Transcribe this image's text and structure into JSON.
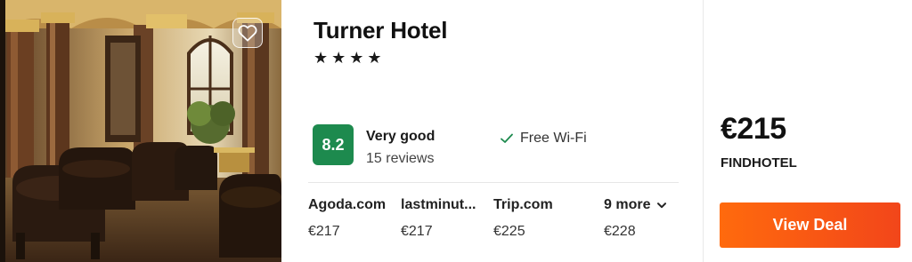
{
  "hotel": {
    "name": "Turner Hotel",
    "stars_text": "★★★★",
    "star_rating": 4
  },
  "rating": {
    "score": "8.2",
    "label": "Very good",
    "reviews": "15 reviews"
  },
  "amenities": [
    {
      "icon": "checkmark-icon",
      "label": "Free Wi-Fi"
    }
  ],
  "providers": [
    {
      "name": "Agoda.com",
      "price": "€217"
    },
    {
      "name": "lastminut...",
      "price": "€217"
    },
    {
      "name": "Trip.com",
      "price": "€225"
    },
    {
      "name": "9 more",
      "price": "€228",
      "icon": "chevron-down-icon"
    }
  ],
  "best_deal": {
    "price": "€215",
    "provider": "FINDHOTEL",
    "button_label": "View Deal"
  },
  "icons": {
    "favorite": "heart-icon"
  },
  "colors": {
    "score_badge": "#1d8a4e",
    "deal_button_start": "#ff6a0d",
    "deal_button_end": "#f2461a",
    "checkmark": "#1d8a4e"
  }
}
